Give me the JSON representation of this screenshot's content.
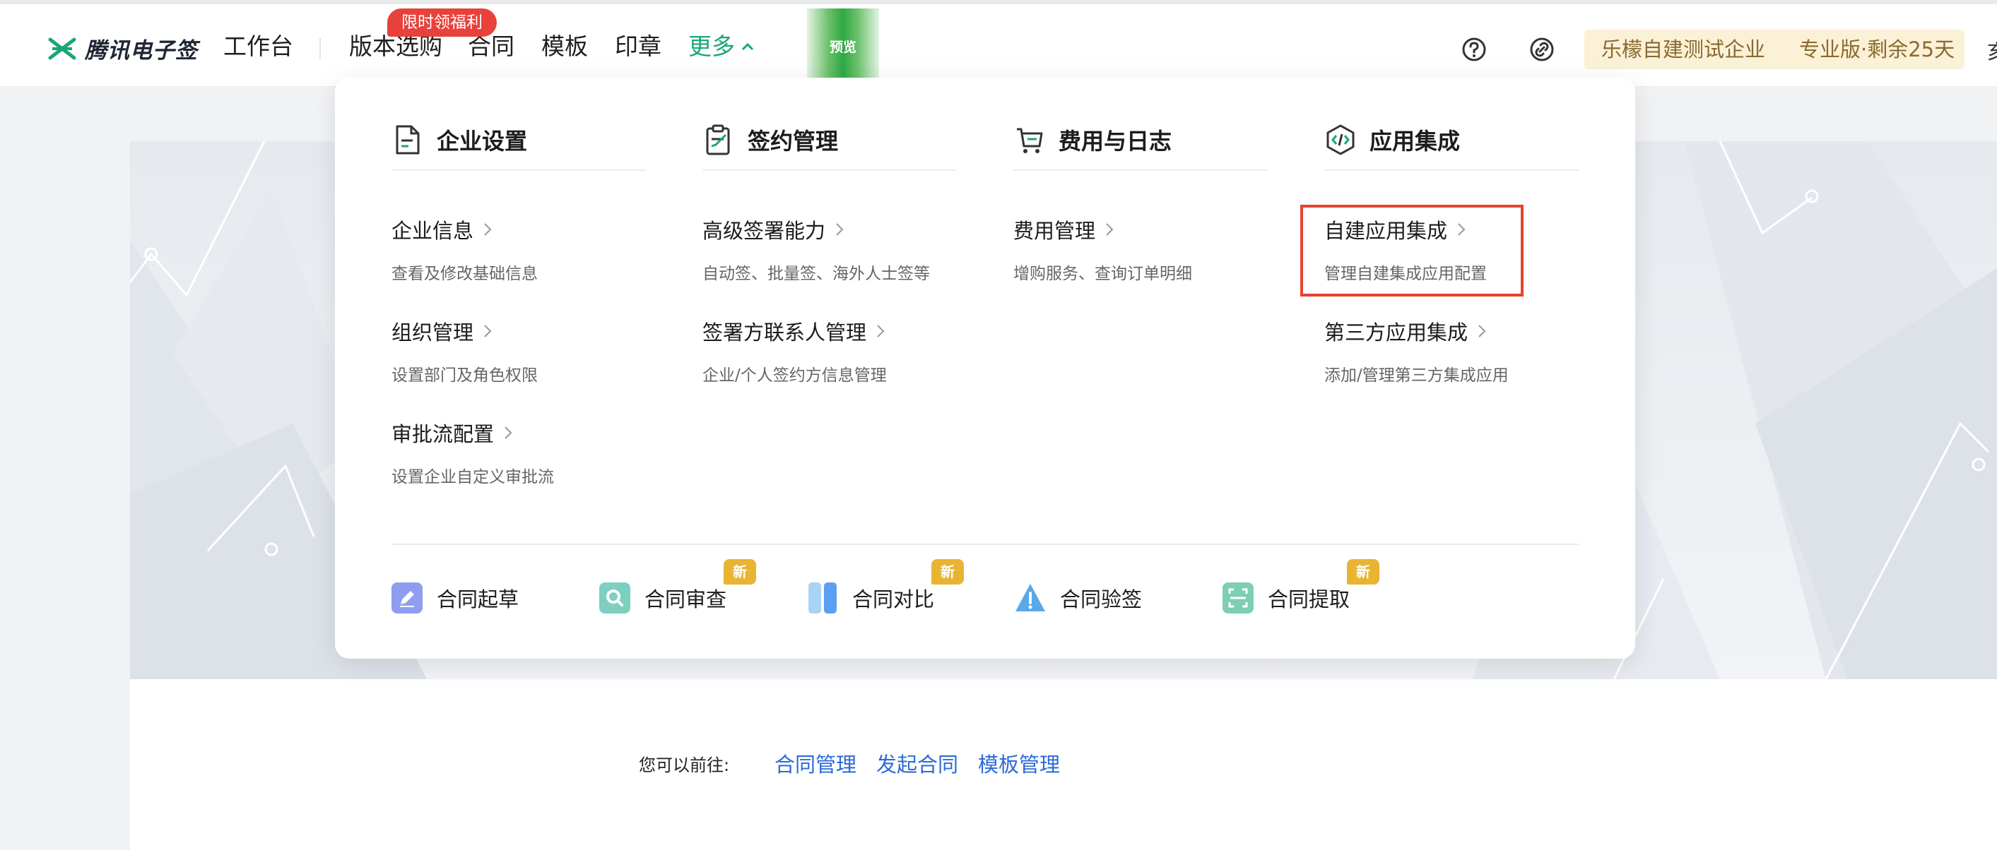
{
  "header": {
    "brand": "腾讯电子签",
    "nav": {
      "workspace": "工作台",
      "versions": "版本选购",
      "contract": "合同",
      "template": "模板",
      "seal": "印章",
      "more": "更多"
    },
    "promo_badge": "限时领福利",
    "preview_label": "预览",
    "enterprise_name": "乐檬自建测试企业",
    "plan": "专业版·剩余25天",
    "edge_glyph": "亥"
  },
  "menu": {
    "columns": [
      {
        "title": "企业设置",
        "icon": "document-icon",
        "items": [
          {
            "title": "企业信息",
            "desc": "查看及修改基础信息"
          },
          {
            "title": "组织管理",
            "desc": "设置部门及角色权限"
          },
          {
            "title": "审批流配置",
            "desc": "设置企业自定义审批流"
          }
        ]
      },
      {
        "title": "签约管理",
        "icon": "clipboard-icon",
        "items": [
          {
            "title": "高级签署能力",
            "desc": "自动签、批量签、海外人士签等"
          },
          {
            "title": "签署方联系人管理",
            "desc": "企业/个人签约方信息管理"
          }
        ]
      },
      {
        "title": "费用与日志",
        "icon": "cart-icon",
        "items": [
          {
            "title": "费用管理",
            "desc": "增购服务、查询订单明细"
          }
        ]
      },
      {
        "title": "应用集成",
        "icon": "code-icon",
        "items": [
          {
            "title": "自建应用集成",
            "desc": "管理自建集成应用配置"
          },
          {
            "title": "第三方应用集成",
            "desc": "添加/管理第三方集成应用"
          }
        ]
      }
    ],
    "tools": [
      {
        "label": "合同起草",
        "icon": "pen-icon",
        "is_new": false
      },
      {
        "label": "合同审查",
        "icon": "magnifier-icon",
        "is_new": true
      },
      {
        "label": "合同对比",
        "icon": "compare-icon",
        "is_new": true
      },
      {
        "label": "合同验签",
        "icon": "warning-icon",
        "is_new": false
      },
      {
        "label": "合同提取",
        "icon": "scan-icon",
        "is_new": true
      }
    ],
    "new_badge": "新"
  },
  "page": {
    "goto_label": "您可以前往:",
    "links": [
      "合同管理",
      "发起合同",
      "模板管理"
    ]
  },
  "colors": {
    "brand_green": "#1aa57a",
    "link_blue": "#2a6ad8",
    "promo_red": "#e8413b",
    "highlight_red": "#e4442f",
    "new_badge": "#e8b432",
    "enterprise_bg": "#fbf1d7",
    "enterprise_text": "#8a6a2f"
  }
}
